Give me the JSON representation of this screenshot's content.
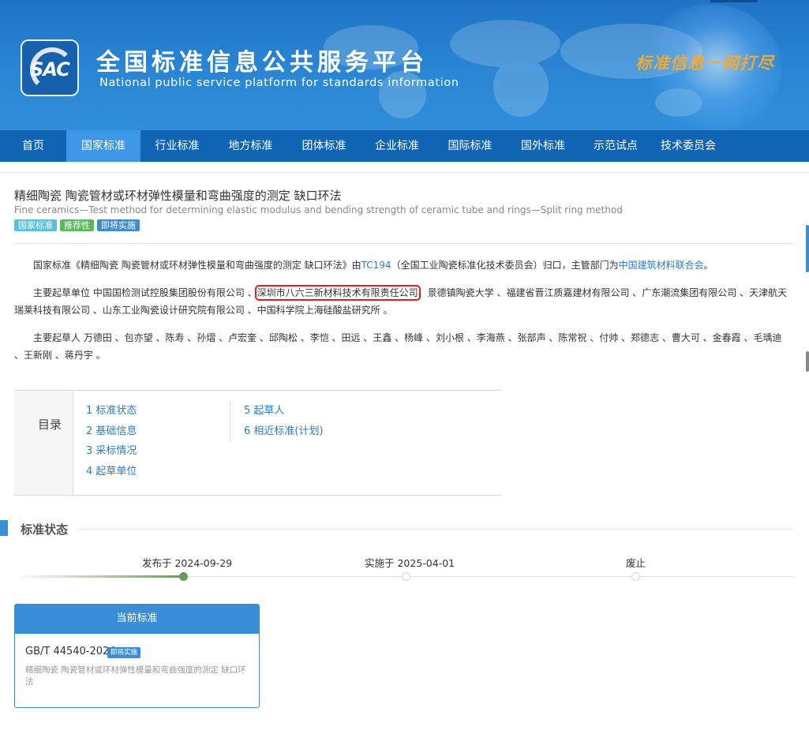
{
  "header": {
    "logo_text": "SAC",
    "site_name_cn": "全国标准信息公共服务平台",
    "site_name_en": "National public service platform  for standards information",
    "slogan": "标准信息一网打尽"
  },
  "nav": {
    "items": [
      {
        "label": "首页"
      },
      {
        "label": "国家标准"
      },
      {
        "label": "行业标准"
      },
      {
        "label": "地方标准"
      },
      {
        "label": "团体标准"
      },
      {
        "label": "企业标准"
      },
      {
        "label": "国际标准"
      },
      {
        "label": "国外标准"
      },
      {
        "label": "示范试点"
      },
      {
        "label": "技术委员会"
      }
    ],
    "active": "国家标准"
  },
  "standard": {
    "title_cn": "精细陶瓷 陶瓷管材或环材弹性模量和弯曲强度的测定 缺口环法",
    "title_en": "Fine ceramics—Test method for determining elastic modulus and bending strength of ceramic tube and rings—Split ring method",
    "tags": [
      {
        "label": "国家标准",
        "color": "#5bc0de"
      },
      {
        "label": "推荐性",
        "color": "#5cb85c"
      },
      {
        "label": "即将实施",
        "color": "#428bca"
      }
    ]
  },
  "intro": {
    "p1_prefix": "国家标准《精细陶瓷 陶瓷管材或环材弹性模量和弯曲强度的测定 缺口环法》由",
    "p1_tc": "TC194",
    "p1_mid": "（全国工业陶瓷标准化技术委员会）归口，主管部门为",
    "p1_dept": "中国建筑材料联合会",
    "p1_suffix": "。",
    "p2_prefix": "主要起草单位 中国国检测试控股集团股份有限公司 、",
    "p2_highlight": "深圳市八六三新材料技术有限责任公司",
    "p2_rest": "、景德镇陶瓷大学 、福建省晋江质嘉建材有限公司 、广东潮流集团有限公司 、天津航天瑞莱科技有限公司 、山东工业陶瓷设计研究院有限公司 、中国科学院上海硅酸盐研究所 。",
    "p3": "主要起草人 万德田 、包亦望 、陈寿 、孙熠 、卢宏奎 、邱陶松 、李恺 、田远 、王鑫 、杨峰 、刘小根 、李海燕 、张部声 、陈常祝 、付帅 、郑德志 、曹大可 、金春霞 、毛瑀迪 、王新刚 、蒋丹宇 。"
  },
  "toc": {
    "label": "目录",
    "col1": [
      "1  标准状态",
      "2  基础信息",
      "3  采标情况",
      "4  起草单位"
    ],
    "col2": [
      "5  起草人",
      "6  相近标准(计划)"
    ]
  },
  "status_section": {
    "title": "标准状态",
    "timeline": {
      "published": "发布于 2024-09-29",
      "effective": "实施于 2025-04-01",
      "abolished": "废止"
    },
    "card": {
      "header": "当前标准",
      "code": "GB/T 44540-2024",
      "badge": "即将实施",
      "desc": "精细陶瓷 陶瓷管材或环材弹性模量和弯曲强度的测定 缺口环法"
    }
  },
  "colors": {
    "nav_bg": "#1064b4",
    "nav_active": "#3d97e6",
    "link": "#2e7bc4",
    "highlight_box": "#e02020",
    "accent": "#3a8ed8",
    "progress": "#6c9a5c"
  }
}
